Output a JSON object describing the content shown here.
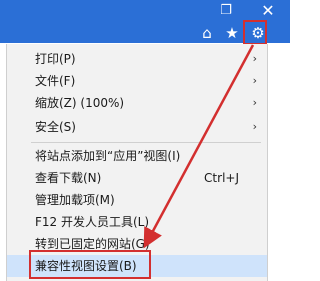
{
  "window": {
    "restore_icon": "restore-icon",
    "close_icon": "close-icon"
  },
  "toolbar": {
    "home_icon": "home-icon",
    "favorites_icon": "star-icon",
    "tools_icon": "gear-icon"
  },
  "colors": {
    "chrome": "#2b6fd6",
    "menu_bg": "#f2f2f2",
    "highlight": "#cfe3fb",
    "annotation": "#d32f2f"
  },
  "menu": {
    "items": [
      {
        "label": "打印(P)",
        "submenu": true
      },
      {
        "label": "文件(F)",
        "submenu": true
      },
      {
        "label": "缩放(Z) (100%)",
        "submenu": true
      },
      {
        "label": "安全(S)",
        "submenu": true
      },
      {
        "label": "将站点添加到“应用”视图(I)",
        "submenu": false
      },
      {
        "label": "查看下载(N)",
        "shortcut": "Ctrl+J",
        "submenu": false
      },
      {
        "label": "管理加载项(M)",
        "submenu": false
      },
      {
        "label": "F12 开发人员工具(L)",
        "submenu": false
      },
      {
        "label": "转到已固定的网站(G)",
        "submenu": false
      },
      {
        "label": "兼容性视图设置(B)",
        "submenu": false,
        "highlighted": true
      }
    ]
  }
}
